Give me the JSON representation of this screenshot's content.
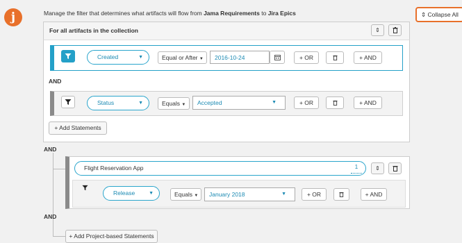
{
  "logo_letter": "j",
  "intro": {
    "prefix": "Manage the filter that determines what artifacts will flow from ",
    "source": "Jama Requirements",
    "middle": " to ",
    "target": "Jira Epics"
  },
  "collapse_all": {
    "icon": "⇕",
    "label": "Collapse All"
  },
  "collection_panel": {
    "title": "For all artifacts in the collection",
    "statements": [
      {
        "field": "Created",
        "operator": "Equal or After",
        "value": "2016-10-24",
        "or_label": "+ OR",
        "and_label": "+ AND"
      },
      {
        "field": "Status",
        "operator": "Equals",
        "value": "Accepted",
        "or_label": "+ OR",
        "and_label": "+ AND"
      }
    ],
    "and_between": "AND",
    "add_statements": "+ Add Statements"
  },
  "and_connector_1": "AND",
  "project_block": {
    "project_name": "Flight Reservation App",
    "project_count": "1",
    "statement": {
      "field": "Release",
      "operator": "Equals",
      "value": "January 2018",
      "or_label": "+ OR",
      "and_label": "+ AND"
    }
  },
  "and_connector_2": "AND",
  "add_project_statements": "+ Add Project-based Statements",
  "icons": {
    "filter": "filter-icon",
    "trash": "trash-icon",
    "calendar": "calendar-icon",
    "expand": "expand-icon",
    "caret": "chevron-down-icon"
  },
  "colors": {
    "brand": "#e8702a",
    "accent": "#24a0c8",
    "muted_bar": "#8a8a8a"
  }
}
